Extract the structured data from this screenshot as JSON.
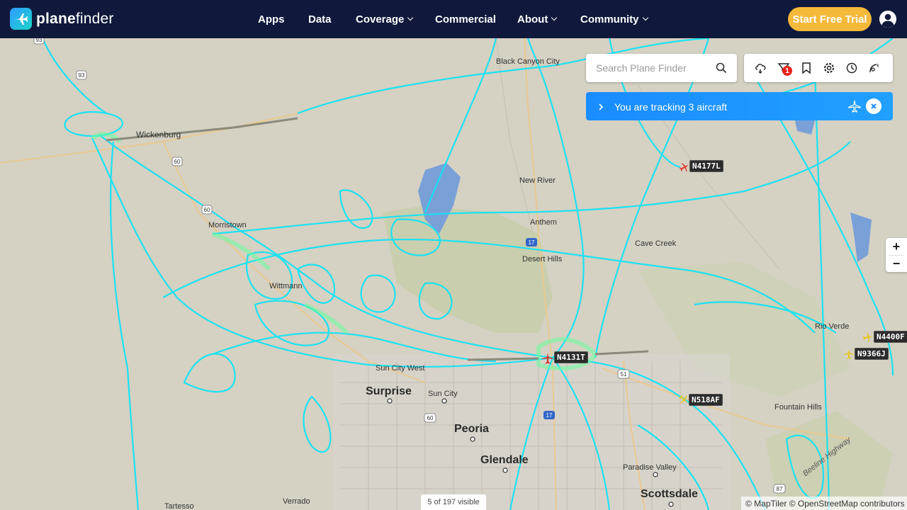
{
  "brand": {
    "name_bold": "plane",
    "name_rest": "finder"
  },
  "nav": {
    "items": [
      {
        "label": "Apps",
        "dropdown": false
      },
      {
        "label": "Data",
        "dropdown": false
      },
      {
        "label": "Coverage",
        "dropdown": true
      },
      {
        "label": "Commercial",
        "dropdown": false
      },
      {
        "label": "About",
        "dropdown": true
      },
      {
        "label": "Community",
        "dropdown": true
      }
    ]
  },
  "header": {
    "trial_label": "Start Free Trial"
  },
  "search": {
    "placeholder": "Search Plane Finder",
    "value": ""
  },
  "toolbar": {
    "icons": [
      "weather-icon",
      "filter-icon",
      "bookmark-icon",
      "settings-icon",
      "history-icon",
      "ar-view-icon"
    ],
    "filter_badge": "1"
  },
  "tracking": {
    "text": "You are tracking 3 aircraft"
  },
  "aircraft": [
    {
      "callsign": "N4177L"
    },
    {
      "callsign": "N4131T"
    },
    {
      "callsign": "N4400F"
    },
    {
      "callsign": "N9366J"
    },
    {
      "callsign": "N518AF"
    }
  ],
  "map_labels": {
    "places_small": [
      "Black Canyon City",
      "Wickenburg",
      "New River",
      "Anthem",
      "Cave Creek",
      "Morristown",
      "Desert Hills",
      "Wittmann",
      "Rio Verde",
      "Sun City West",
      "Sun City",
      "Fountain Hills",
      "Paradise Valley",
      "Verrado",
      "Tartesso"
    ],
    "places_large": [
      "Surprise",
      "Peoria",
      "Glendale",
      "Scottsdale"
    ],
    "roads": [
      "93",
      "93",
      "60",
      "60",
      "17",
      "51",
      "60",
      "17",
      "87"
    ],
    "highway_label": "Beeline Highway"
  },
  "zoom": {
    "in": "+",
    "out": "−"
  },
  "status": {
    "visible_count": "5 of 197 visible"
  },
  "attribution": "© MapTiler © OpenStreetMap contributors",
  "colors": {
    "header_bg": "#10193b",
    "accent": "#f5b93a",
    "track": "#10e0f5",
    "track_fill": "#5dff9a",
    "tracking_banner": "#1a8cff"
  }
}
